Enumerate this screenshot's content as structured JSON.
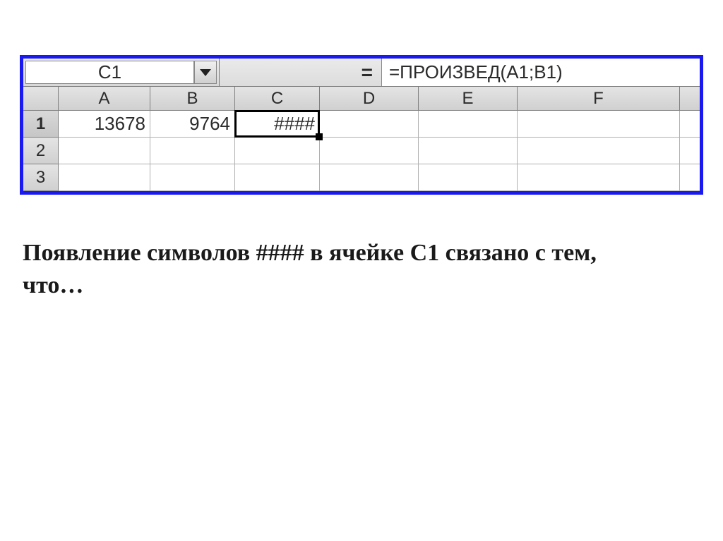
{
  "formula_bar": {
    "cell_ref": "C1",
    "eq_sign": "=",
    "formula": "=ПРОИЗВЕД(A1;B1)"
  },
  "columns": [
    "A",
    "B",
    "C",
    "D",
    "E",
    "F"
  ],
  "rows": [
    "1",
    "2",
    "3"
  ],
  "selected_row": "1",
  "selected_cell": "C1",
  "cells": {
    "A1": "13678",
    "B1": "9764",
    "C1": "####"
  },
  "question_text": "Появление символов #### в ячейке С1 связано с тем, что…"
}
